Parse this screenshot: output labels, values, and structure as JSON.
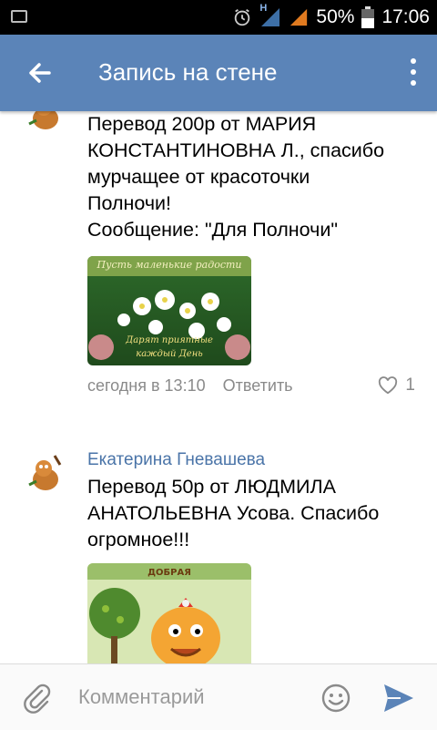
{
  "status_bar": {
    "battery": "50%",
    "time": "17:06",
    "network": "H"
  },
  "app_bar": {
    "title": "Запись на стене"
  },
  "comments": [
    {
      "lines": [
        "Перевод 200р от МАРИЯ",
        "КОНСТАНТИНОВНА Л., спасибо",
        "мурчащее от красоточки",
        "Полночи!",
        "Сообщение: \"Для Полночи\""
      ],
      "image_text": [
        "Пусть маленькие радости",
        "Дарят приятные",
        "каждый День"
      ],
      "time": "сегодня в 13:10",
      "reply": "Ответить",
      "likes": "1"
    },
    {
      "author": "Екатерина Гневашева",
      "lines": [
        "Перевод 50р от ЛЮДМИЛА",
        "АНАТОЛЬЕВНА Усова. Спасибо",
        "огромное!!!"
      ],
      "image_text": "ДОБРАЯ"
    }
  ],
  "comment_bar": {
    "placeholder": "Комментарий"
  }
}
